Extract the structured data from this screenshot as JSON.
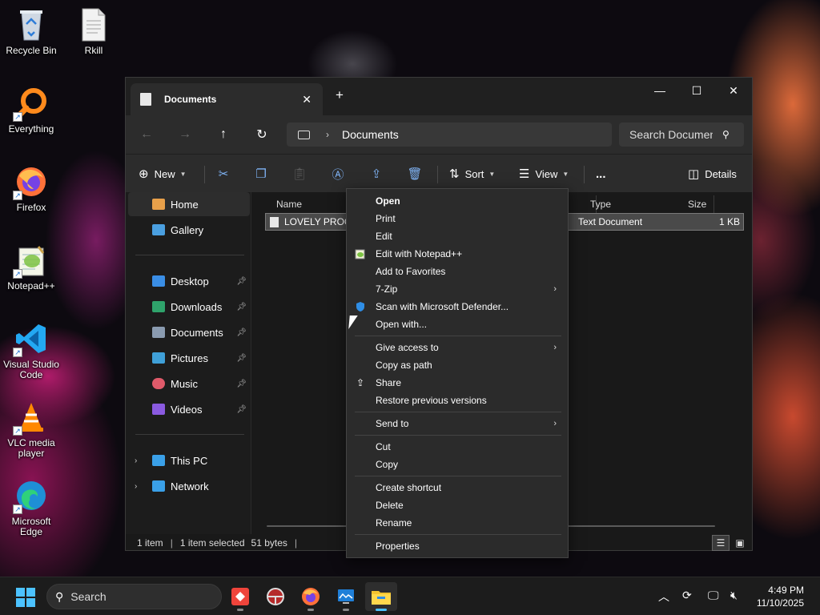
{
  "desktop": {
    "icons": [
      {
        "label": "Recycle Bin",
        "icon": "recycle-bin-icon"
      },
      {
        "label": "Rkill",
        "icon": "document-icon"
      },
      {
        "label": "Everything",
        "icon": "everything-search-icon"
      },
      {
        "label": "Firefox",
        "icon": "firefox-icon"
      },
      {
        "label": "Notepad++",
        "icon": "notepad-plus-plus-icon"
      },
      {
        "label": "Visual Studio Code",
        "icon": "vscode-icon"
      },
      {
        "label": "VLC media player",
        "icon": "vlc-icon"
      },
      {
        "label": "Microsoft Edge",
        "icon": "edge-icon"
      }
    ]
  },
  "window": {
    "tab_title": "Documents",
    "breadcrumb": "Documents",
    "search_placeholder": "Search Documents",
    "commands": {
      "new": "New",
      "sort": "Sort",
      "view": "View",
      "more": "...",
      "details": "Details"
    },
    "nav": {
      "home": "Home",
      "gallery": "Gallery",
      "desktop": "Desktop",
      "downloads": "Downloads",
      "documents": "Documents",
      "pictures": "Pictures",
      "music": "Music",
      "videos": "Videos",
      "this_pc": "This PC",
      "network": "Network"
    },
    "columns": {
      "name": "Name",
      "type": "Type",
      "size": "Size"
    },
    "file": {
      "name": "LOVELY PROGR",
      "type": "Text Document",
      "size": "1 KB"
    },
    "status": {
      "count": "1 item",
      "selected": "1 item selected",
      "bytes": "51 bytes"
    }
  },
  "context_menu": {
    "items": [
      {
        "label": "Open",
        "bold": true
      },
      {
        "label": "Print"
      },
      {
        "label": "Edit"
      },
      {
        "label": "Edit with Notepad++",
        "icon": "notepad-plus-plus-icon"
      },
      {
        "label": "Add to Favorites"
      },
      {
        "label": "7-Zip",
        "submenu": true
      },
      {
        "label": "Scan with Microsoft Defender...",
        "icon": "defender-shield-icon"
      },
      {
        "label": "Open with..."
      },
      {
        "label": "Give access to",
        "submenu": true
      },
      {
        "label": "Copy as path"
      },
      {
        "label": "Share",
        "icon": "share-icon"
      },
      {
        "label": "Restore previous versions"
      },
      {
        "label": "Send to",
        "submenu": true
      },
      {
        "label": "Cut"
      },
      {
        "label": "Copy"
      },
      {
        "label": "Create shortcut"
      },
      {
        "label": "Delete"
      },
      {
        "label": "Rename"
      },
      {
        "label": "Properties"
      }
    ]
  },
  "taskbar": {
    "search_label": "Search",
    "time": "4:49 PM",
    "date": "11/10/2025"
  },
  "colors": {
    "accent": "#4cc2ff",
    "menu_bg": "#2b2b2b",
    "window_bg": "#191919"
  }
}
